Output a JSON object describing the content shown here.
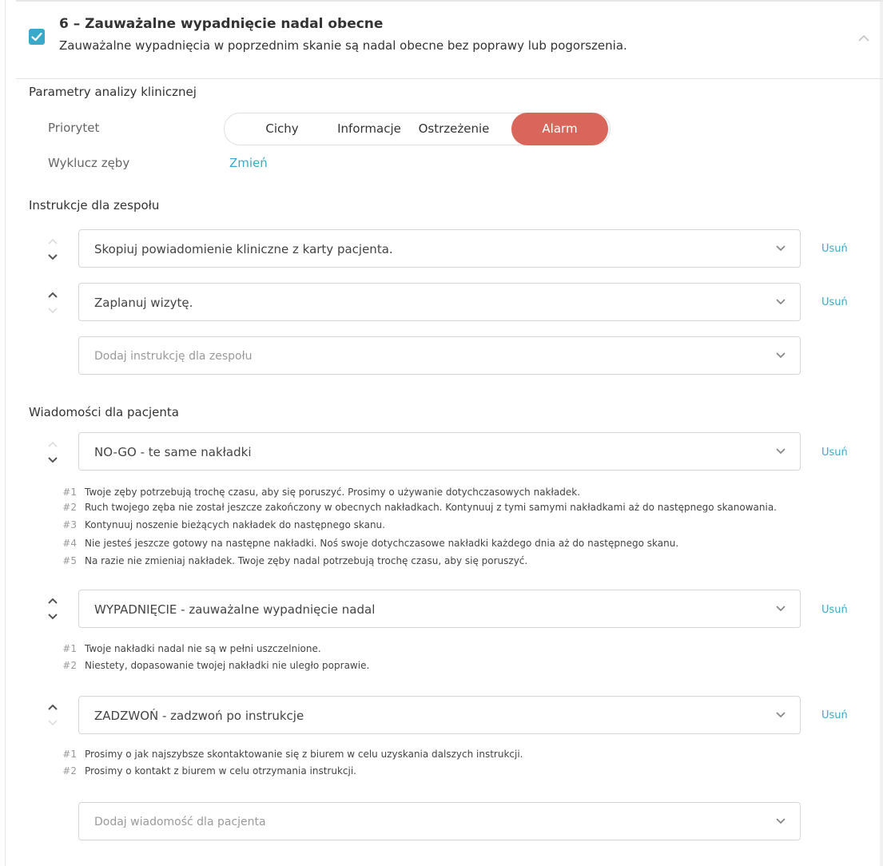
{
  "header": {
    "title": "6 – Zauważalne wypadnięcie nadal obecne",
    "subtitle": "Zauważalne wypadnięcia w poprzednim skanie są nadal obecne bez poprawy lub pogorszenia.",
    "checked": true,
    "accent_color": "#3aa9c9"
  },
  "params": {
    "section_title": "Parametry analizy klinicznej",
    "priority_label": "Priorytet",
    "priority_options": [
      "Cichy",
      "Informacje",
      "Ostrzeżenie",
      "Alarm"
    ],
    "priority_selected": "Alarm",
    "priority_active_color": "#d9665a",
    "exclude_label": "Wyklucz zęby",
    "exclude_link": "Zmień"
  },
  "team": {
    "section_title": "Instrukcje dla zespołu",
    "items": [
      {
        "value": "Skopiuj powiadomienie kliniczne z karty pacjenta.",
        "remove": "Usuń"
      },
      {
        "value": "Zaplanuj wizytę.",
        "remove": "Usuń"
      }
    ],
    "add_placeholder": "Dodaj instrukcję dla zespołu"
  },
  "patient": {
    "section_title": "Wiadomości dla pacjenta",
    "items": [
      {
        "value": "NO-GO - te same nakładki",
        "remove": "Usuń",
        "messages": [
          {
            "num": "#1",
            "text": "Twoje zęby potrzebują trochę czasu, aby się poruszyć. Prosimy o używanie dotychczasowych nakładek."
          },
          {
            "num": "#2",
            "text": "Ruch twojego zęba nie został jeszcze zakończony w obecnych nakładkach. Kontynuuj z tymi samymi nakładkami aż do następnego skanowania."
          },
          {
            "num": "#3",
            "text": "Kontynuuj noszenie bieżących nakładek do następnego skanu."
          },
          {
            "num": "#4",
            "text": "Nie jesteś jeszcze gotowy na następne nakładki. Noś swoje dotychczasowe nakładki każdego dnia aż do następnego skanu."
          },
          {
            "num": "#5",
            "text": "Na razie nie zmieniaj nakładek. Twoje zęby nadal potrzebują trochę czasu, aby się poruszyć."
          }
        ]
      },
      {
        "value": "WYPADNIĘCIE - zauważalne wypadnięcie nadal",
        "remove": "Usuń",
        "messages": [
          {
            "num": "#1",
            "text": "Twoje nakładki nadal nie są w pełni uszczelnione."
          },
          {
            "num": "#2",
            "text": "Niestety, dopasowanie twojej nakładki nie uległo poprawie."
          }
        ]
      },
      {
        "value": "ZADZWOŃ - zadzwoń po instrukcje",
        "remove": "Usuń",
        "messages": [
          {
            "num": "#1",
            "text": "Prosimy o jak najszybsze skontaktowanie się z biurem w celu uzyskania dalszych instrukcji."
          },
          {
            "num": "#2",
            "text": "Prosimy o kontakt z biurem w celu otrzymania instrukcji."
          }
        ]
      }
    ],
    "add_placeholder": "Dodaj wiadomość dla pacjenta"
  }
}
